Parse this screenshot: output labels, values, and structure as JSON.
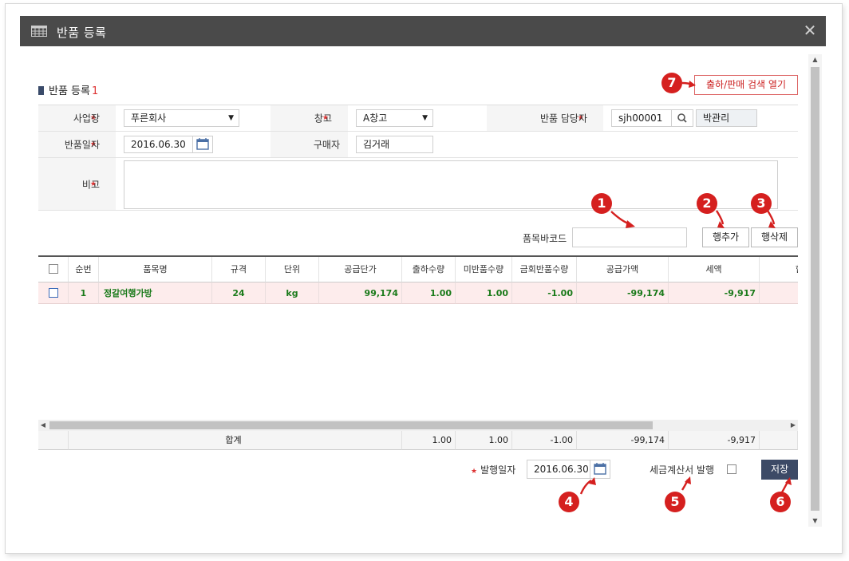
{
  "window": {
    "title": "반품 등록"
  },
  "section": {
    "title": "반품 등록",
    "num": "1"
  },
  "open_search_button": "출하/판매 검색 열기",
  "form": {
    "business_label": "사업장",
    "business_value": "푸른회사",
    "warehouse_label": "창고",
    "warehouse_value": "A창고",
    "manager_label": "반품 담당자",
    "manager_id": "sjh00001",
    "manager_name": "박관리",
    "return_date_label": "반품일자",
    "return_date_value": "2016.06.30",
    "buyer_label": "구매자",
    "buyer_value": "김거래",
    "note_label": "비고",
    "note_value": ""
  },
  "toolbar": {
    "barcode_label": "품목바코드",
    "barcode_value": "",
    "add_row": "행추가",
    "delete_row": "행삭제"
  },
  "grid": {
    "headers": [
      "순번",
      "품목명",
      "규격",
      "단위",
      "공급단가",
      "출하수량",
      "미반품수량",
      "금회반품수량",
      "공급가액",
      "세액",
      "합"
    ],
    "rows": [
      [
        "1",
        "정갈여행가방",
        "24",
        "kg",
        "99,174",
        "1.00",
        "1.00",
        "-1.00",
        "-99,174",
        "-9,917",
        ""
      ]
    ],
    "totals": {
      "label": "합계",
      "ship_qty": "1.00",
      "unreturned_qty": "1.00",
      "return_qty": "-1.00",
      "supply_amount": "-99,174",
      "tax": "-9,917"
    }
  },
  "bottom": {
    "issue_date_label": "발행일자",
    "issue_date_value": "2016.06.30",
    "tax_invoice_label": "세금계산서 발행",
    "save": "저장"
  },
  "callouts": [
    "1",
    "2",
    "3",
    "4",
    "5",
    "6",
    "7"
  ],
  "colors": {
    "titlebar": "#4a4a4a",
    "accent_red": "#d5201f",
    "save_button": "#3c4a66",
    "row_highlight": "#fdecec",
    "data_text": "#1a7a1a"
  }
}
